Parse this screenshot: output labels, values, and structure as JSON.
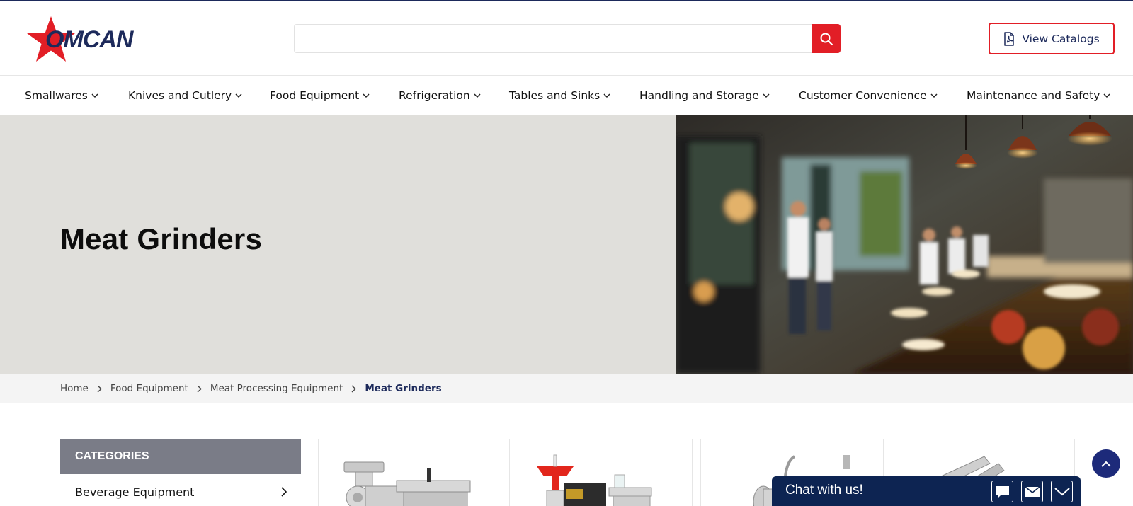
{
  "brand": {
    "logo_text": "OMCAN",
    "primary_color": "#1d2a5b",
    "accent_color": "#e21e26"
  },
  "header": {
    "search": {
      "value": "",
      "placeholder": "",
      "button_icon": "search-icon"
    },
    "catalog_button": {
      "label": "View Catalogs",
      "icon": "pdf-file-icon"
    }
  },
  "nav": {
    "items": [
      {
        "label": "Smallwares"
      },
      {
        "label": "Knives and Cutlery"
      },
      {
        "label": "Food Equipment"
      },
      {
        "label": "Refrigeration"
      },
      {
        "label": "Tables and Sinks"
      },
      {
        "label": "Handling and Storage"
      },
      {
        "label": "Customer Convenience"
      },
      {
        "label": "Maintenance and Safety"
      }
    ]
  },
  "hero": {
    "title": "Meat Grinders",
    "image": "blurred-restaurant-kitchen-photo"
  },
  "breadcrumb": {
    "items": [
      "Home",
      "Food Equipment",
      "Meat Processing Equipment"
    ],
    "current": "Meat Grinders"
  },
  "sidebar": {
    "heading": "CATEGORIES",
    "items": [
      {
        "label": "Beverage Equipment"
      }
    ]
  },
  "products": [
    {
      "image": "meat-grinder-stainless-photo"
    },
    {
      "image": "meat-grinder-red-hopper-photo"
    },
    {
      "image": "meat-grinder-attachment-photo"
    },
    {
      "image": "grinder-part-photo"
    }
  ],
  "chat": {
    "label": "Chat with us!",
    "buttons": [
      "chat-bubble-icon",
      "mail-icon",
      "minimize-chevron-icon"
    ]
  },
  "scroll_top": {
    "icon": "chevron-up-icon"
  }
}
